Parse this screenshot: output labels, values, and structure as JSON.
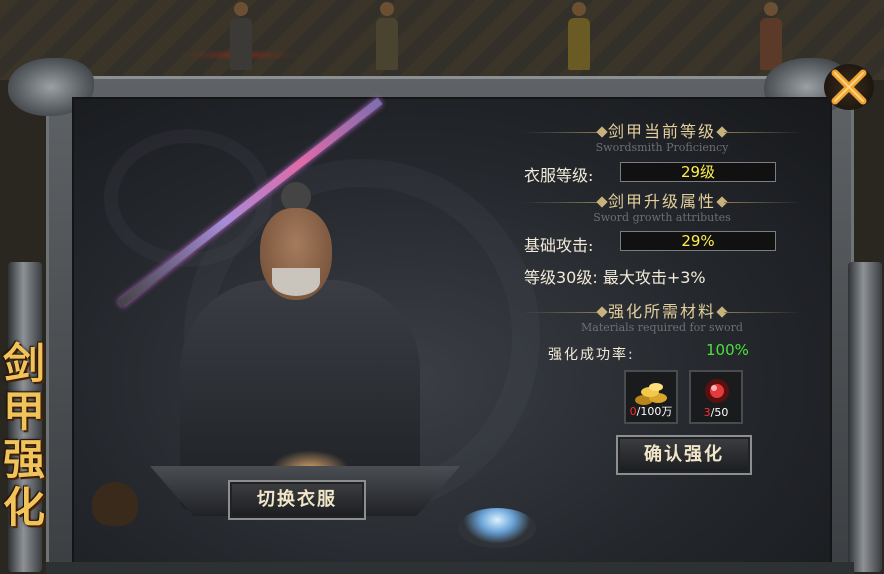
{
  "panel": {
    "vertical_title": [
      "剑",
      "甲",
      "强",
      "化"
    ],
    "close_icon": "close-x-icon"
  },
  "proficiency": {
    "title": "剑甲当前等级",
    "subtitle": "Swordsmith Proficiency",
    "clothing_level_label": "衣服等级:",
    "clothing_level_value": "29级"
  },
  "growth": {
    "title": "剑甲升级属性",
    "subtitle": "Sword growth attributes",
    "base_attack_label": "基础攻击:",
    "base_attack_value": "29%",
    "next_level_text": "等级30级: 最大攻击+3%"
  },
  "materials": {
    "title": "强化所需材料",
    "subtitle": "Materials required for sword",
    "success_label": "强化成功率:",
    "success_value": "100%",
    "items": [
      {
        "icon": "gold-coins-icon",
        "owned": "0",
        "required": "/100万"
      },
      {
        "icon": "red-gem-icon",
        "owned": "3",
        "required": "/50"
      }
    ]
  },
  "buttons": {
    "confirm": "确认强化",
    "switch_clothes": "切换衣服"
  },
  "colors": {
    "value_yellow": "#fff04a",
    "success_green": "#4de13b",
    "owned_red": "#ff2b2b",
    "title_gold": "#e3cf9c"
  }
}
